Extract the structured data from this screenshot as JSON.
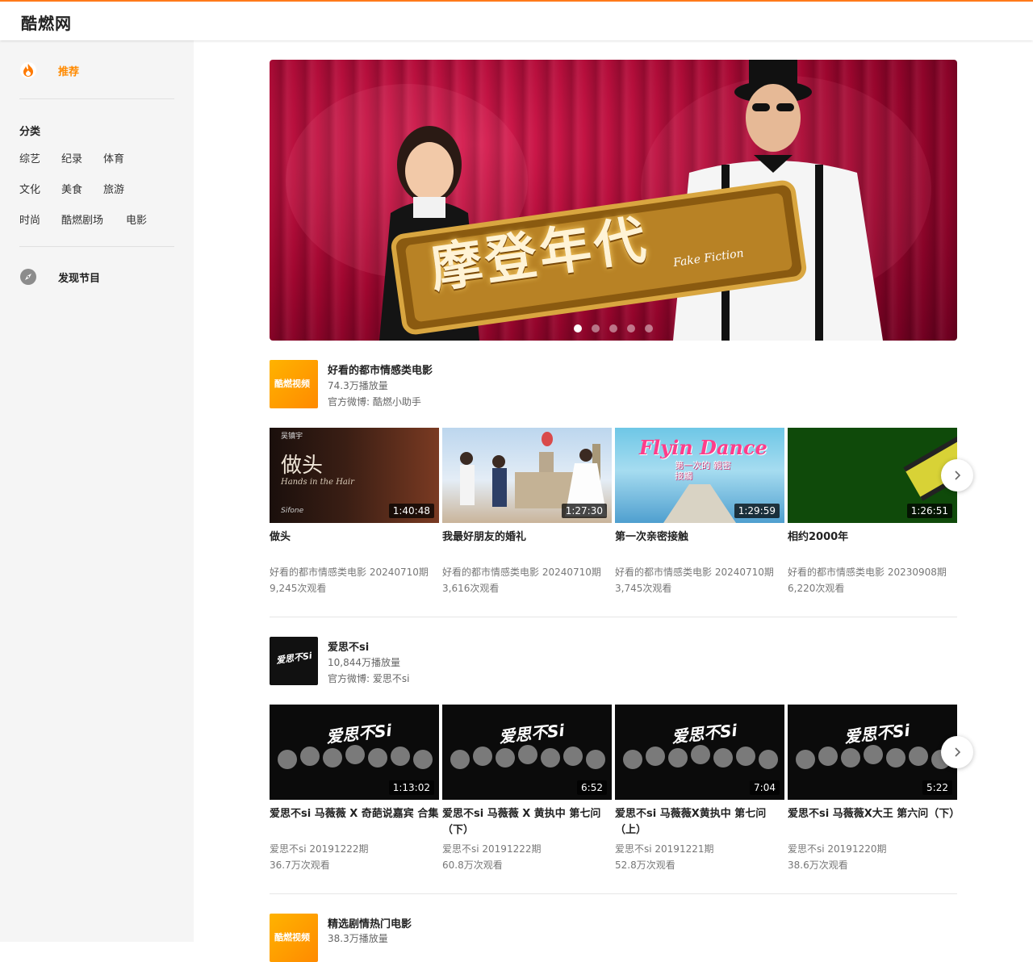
{
  "app": {
    "logo": "酷燃网"
  },
  "sidebar": {
    "recommend": "推荐",
    "category_title": "分类",
    "categories": [
      "综艺",
      "纪录",
      "体育",
      "文化",
      "美食",
      "旅游",
      "时尚",
      "酷燃剧场",
      "电影"
    ],
    "discover": "发现节目"
  },
  "banner": {
    "title_text": "摩登年代",
    "subtitle_text": "Fake Fiction",
    "slides": 5,
    "active_slide": 1
  },
  "sections": [
    {
      "name": "好看的都市情感类电影",
      "plays": "74.3万播放量",
      "weibo": "官方微博: 酷燃小助手",
      "logo_text": "酷燃视频",
      "videos": [
        {
          "title": "做头",
          "duration": "1:40:48",
          "meta": "好看的都市情感类电影 20240710期",
          "views": "9,245次观看",
          "thumb_text": "做头",
          "thumb_sub": "Hands in the Hair",
          "thumb_top": "吴镇宇",
          "thumb_brand": "Sifone"
        },
        {
          "title": "我最好朋友的婚礼",
          "duration": "1:27:30",
          "meta": "好看的都市情感类电影 20240710期",
          "views": "3,616次观看"
        },
        {
          "title": "第一次亲密接触",
          "duration": "1:29:59",
          "meta": "好看的都市情感类电影 20240710期",
          "views": "3,745次观看",
          "thumb_text": "Flyin Dance",
          "thumb_sub": "第一次的 親密接觸"
        },
        {
          "title": "相约2000年",
          "duration": "1:26:51",
          "meta": "好看的都市情感类电影 20230908期",
          "views": "6,220次观看"
        }
      ]
    },
    {
      "name": "爱思不si",
      "plays": "10,844万播放量",
      "weibo": "官方微博: 爱思不si",
      "logo_text": "爱思不Si",
      "videos": [
        {
          "title": "爱思不si 马薇薇 X 奇葩说嘉宾 合集",
          "duration": "1:13:02",
          "meta": "爱思不si 20191222期",
          "views": "36.7万次观看",
          "thumb_text": "爱思不Si"
        },
        {
          "title": "爱思不si 马薇薇 X 黄执中 第七问（下）",
          "duration": "6:52",
          "meta": "爱思不si 20191222期",
          "views": "60.8万次观看",
          "thumb_text": "爱思不Si"
        },
        {
          "title": "爱思不si 马薇薇X黄执中 第七问（上）",
          "duration": "7:04",
          "meta": "爱思不si 20191221期",
          "views": "52.8万次观看",
          "thumb_text": "爱思不Si"
        },
        {
          "title": "爱思不si 马薇薇X大王 第六问（下）",
          "duration": "5:22",
          "meta": "爱思不si 20191220期",
          "views": "38.6万次观看",
          "thumb_text": "爱思不Si"
        }
      ]
    },
    {
      "name": "精选剧情热门电影",
      "plays": "38.3万播放量",
      "logo_text": "酷燃视频"
    }
  ],
  "colors": {
    "accent": "#ff8a00",
    "topline": "#ff7a1a",
    "sidebar_bg": "#f5f5f5"
  }
}
